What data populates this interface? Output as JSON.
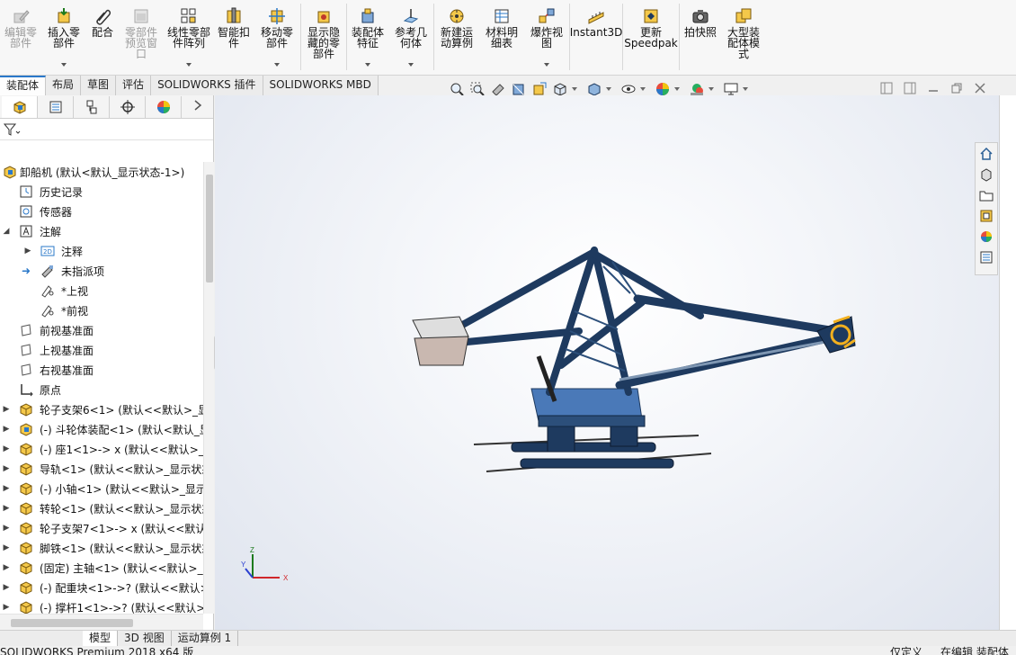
{
  "ribbon": {
    "buttons": [
      {
        "id": "edit-part",
        "label": "编辑零\n部件",
        "icon": "edit-component-icon",
        "disabled": true
      },
      {
        "id": "insert-parts",
        "label": "插入零\n部件",
        "icon": "insert-component-icon"
      },
      {
        "id": "mate",
        "label": "配合",
        "icon": "paperclip-icon"
      },
      {
        "id": "component-preview",
        "label": "零部件\n预览窗\n口",
        "icon": "preview-window-icon",
        "disabled": true
      },
      {
        "id": "linear-pattern",
        "label": "线性零部\n件阵列",
        "icon": "linear-pattern-icon"
      },
      {
        "id": "smart-fasteners",
        "label": "智能扣\n件",
        "icon": "smart-fastener-icon"
      },
      {
        "id": "move-component",
        "label": "移动零\n部件",
        "icon": "move-component-icon"
      },
      {
        "id": "show-hidden",
        "label": "显示隐\n藏的零\n部件",
        "icon": "show-hidden-icon"
      },
      {
        "id": "assembly-features",
        "label": "装配体\n特征",
        "icon": "assembly-feature-icon"
      },
      {
        "id": "reference-geometry",
        "label": "参考几\n何体",
        "icon": "reference-geometry-icon"
      },
      {
        "id": "new-motion-study",
        "label": "新建运\n动算例",
        "icon": "motion-study-icon"
      },
      {
        "id": "bill-of-materials",
        "label": "材料明\n细表",
        "icon": "bom-icon"
      },
      {
        "id": "exploded-view",
        "label": "爆炸视\n图",
        "icon": "exploded-view-icon"
      },
      {
        "id": "instant3d",
        "label": "Instant3D",
        "icon": "instant3d-icon"
      },
      {
        "id": "update-speedpak",
        "label": "更新\nSpeedpak",
        "icon": "speedpak-icon"
      },
      {
        "id": "take-snapshot",
        "label": "拍快照",
        "icon": "camera-icon"
      },
      {
        "id": "large-assembly",
        "label": "大型装\n配体模\n式",
        "icon": "large-assembly-icon"
      }
    ]
  },
  "command_tabs": [
    {
      "label": "装配体",
      "active": true
    },
    {
      "label": "布局"
    },
    {
      "label": "草图"
    },
    {
      "label": "评估"
    },
    {
      "label": "SOLIDWORKS 插件"
    },
    {
      "label": "SOLIDWORKS MBD"
    }
  ],
  "tree": {
    "root": "卸船机 (默认<默认_显示状态-1>)",
    "items": [
      {
        "label": "历史记录",
        "icon": "history-icon",
        "level": 1
      },
      {
        "label": "传感器",
        "icon": "sensor-icon",
        "level": 1
      },
      {
        "label": "注解",
        "icon": "annotation-icon",
        "level": 1,
        "expanded": true
      },
      {
        "label": "注释",
        "icon": "notes-2d-icon",
        "level": 2,
        "collapsed": true
      },
      {
        "label": "未指派项",
        "icon": "unassigned-icon",
        "level": 2,
        "arrow": true
      },
      {
        "label": "*上视",
        "icon": "view-orient-icon",
        "level": 2
      },
      {
        "label": "*前视",
        "icon": "view-orient-icon",
        "level": 2
      },
      {
        "label": "前视基准面",
        "icon": "plane-icon",
        "level": 1
      },
      {
        "label": "上视基准面",
        "icon": "plane-icon",
        "level": 1
      },
      {
        "label": "右视基准面",
        "icon": "plane-icon",
        "level": 1
      },
      {
        "label": "原点",
        "icon": "origin-icon",
        "level": 1
      },
      {
        "label": "轮子支架6<1> (默认<<默认>_显",
        "icon": "part-icon",
        "level": 1,
        "collapsed": true
      },
      {
        "label": "(-) 斗轮体装配<1> (默认<默认_显",
        "icon": "subassembly-icon",
        "level": 1,
        "collapsed": true
      },
      {
        "label": "(-) 座1<1>-> x (默认<<默认>_显",
        "icon": "part-icon",
        "level": 1,
        "collapsed": true
      },
      {
        "label": "导轨<1> (默认<<默认>_显示状态",
        "icon": "part-icon",
        "level": 1,
        "collapsed": true
      },
      {
        "label": "(-) 小轴<1> (默认<<默认>_显示",
        "icon": "part-icon",
        "level": 1,
        "collapsed": true
      },
      {
        "label": "转轮<1> (默认<<默认>_显示状态",
        "icon": "part-icon",
        "level": 1,
        "collapsed": true
      },
      {
        "label": "轮子支架7<1>-> x (默认<<默认",
        "icon": "part-icon",
        "level": 1,
        "collapsed": true
      },
      {
        "label": "脚铁<1> (默认<<默认>_显示状态",
        "icon": "part-icon",
        "level": 1,
        "collapsed": true
      },
      {
        "label": "(固定) 主轴<1> (默认<<默认>_显",
        "icon": "part-icon",
        "level": 1,
        "collapsed": true
      },
      {
        "label": "(-) 配重块<1>->? (默认<<默认>_",
        "icon": "part-icon",
        "level": 1,
        "collapsed": true
      },
      {
        "label": "(-) 撑杆1<1>->? (默认<<默认>_",
        "icon": "part-icon",
        "level": 1,
        "collapsed": true
      }
    ]
  },
  "triad": {
    "x": "X",
    "y": "Y",
    "z": "Z"
  },
  "bottom_tabs": [
    {
      "label": "模型",
      "active": true
    },
    {
      "label": "3D 视图"
    },
    {
      "label": "运动算例 1"
    }
  ],
  "status": {
    "product": "SOLIDWORKS Premium 2018 x64 版",
    "custom": "仅定义",
    "editing": "在编辑 装配体"
  },
  "colors": {
    "accent": "#2a78c9",
    "model_blue": "#1e3a5f",
    "part_yellow": "#f2b01e"
  }
}
